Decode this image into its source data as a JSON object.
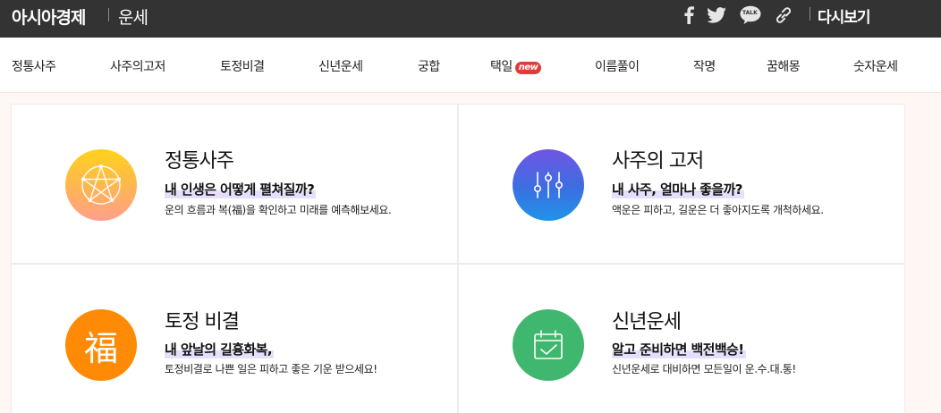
{
  "header": {
    "brand": "아시아경제",
    "section": "운세",
    "share_icons": [
      "facebook-icon",
      "twitter-icon",
      "kakaotalk-icon",
      "link-icon"
    ],
    "kakao_label": "TALK",
    "replay": "다시보기",
    "bar_color": "#333333"
  },
  "nav": {
    "items": [
      {
        "label": "정통사주"
      },
      {
        "label": "사주의고저"
      },
      {
        "label": "토정비결"
      },
      {
        "label": "신년운세"
      },
      {
        "label": "궁합"
      },
      {
        "label": "택일",
        "badge": "new"
      },
      {
        "label": "이름풀이"
      },
      {
        "label": "작명"
      },
      {
        "label": "꿈해몽"
      },
      {
        "label": "숫자운세"
      }
    ]
  },
  "cards": [
    {
      "title": "정통사주",
      "subtitle": "내 인생은 어떻게 펼쳐질까?",
      "description": "운의 흐름과 복(福)을 확인하고 미래를 예측해보세요.",
      "icon": "pentagram-icon",
      "color": "#ffc23a"
    },
    {
      "title": "사주의 고저",
      "subtitle": "내 사주, 얼마나 좋을까?",
      "description": "액운은 피하고, 길운은 더 좋아지도록 개척하세요.",
      "icon": "sliders-icon",
      "color": "#4a63e2"
    },
    {
      "title": "토정 비결",
      "subtitle": "내 앞날의 길흉화복,",
      "description": "토정비결로 나쁜 일은 피하고 좋은 기운 받으세요!",
      "icon": "fortune-character-icon",
      "glyph": "福",
      "color": "#ff8a06"
    },
    {
      "title": "신년운세",
      "subtitle": "알고 준비하면 백전백승!",
      "description": "신년운세로 대비하면 모든일이 운.수.대.통!",
      "icon": "calendar-check-icon",
      "color": "#3fb76e"
    }
  ]
}
